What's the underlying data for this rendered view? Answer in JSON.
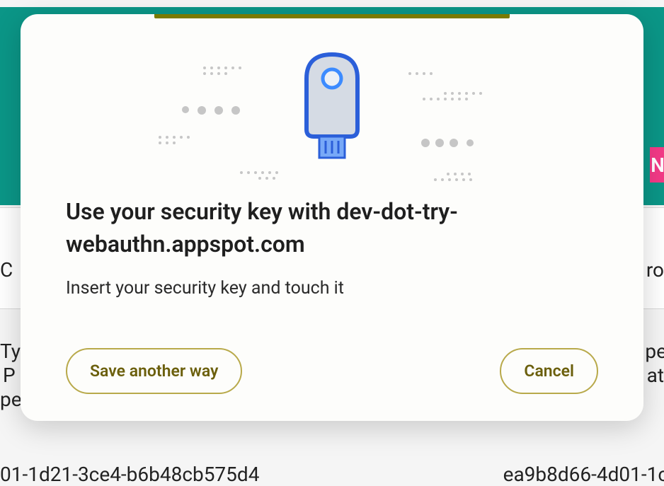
{
  "background": {
    "pink_text": "N",
    "left_col_header_fragment": "C",
    "right_col_header_fragment": "ro",
    "left_text_fragment_1": "Ty",
    "left_text_fragment_2": "P",
    "left_text_fragment_3": "pe",
    "right_text_fragment_1": "pe",
    "right_text_fragment_2": "at",
    "bottom_left_fragment": "01-1d21-3ce4-b6b48cb575d4",
    "bottom_right_fragment": "ea9b8d66-4d01-1c"
  },
  "dialog": {
    "title": "Use your security key with dev-dot-try-webauthn.appspot.com",
    "message": "Insert your security key and touch it",
    "save_another_way_label": "Save another way",
    "cancel_label": "Cancel"
  }
}
